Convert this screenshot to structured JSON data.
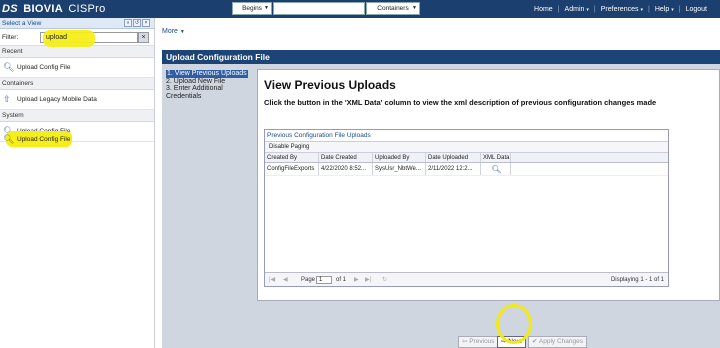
{
  "header": {
    "logo_prefix": "DS",
    "brand": "BIOVIA",
    "product": "CISPro",
    "search_mode": "Begins",
    "search_value": "",
    "search_scope": "Containers",
    "nav": [
      "Home",
      "Admin",
      "Preferences",
      "Help",
      "Logout"
    ]
  },
  "sidebar": {
    "title": "Select a View",
    "controls": [
      "«",
      "↺",
      "×"
    ],
    "filter_label": "Filter:",
    "filter_value": "upload",
    "clear": "×",
    "groups": [
      {
        "name": "Recent",
        "item": "Upload Config File",
        "icon": "magnifier-icon"
      },
      {
        "name": "Containers",
        "item": "Upload Legacy Mobile Data",
        "icon": "upload-arrow-icon"
      },
      {
        "name": "System",
        "item": "Upload Config File",
        "icon": "magnifier-icon"
      }
    ]
  },
  "main": {
    "more": "More",
    "panel_title": "Upload Configuration File",
    "steps": [
      "1. View Previous Uploads",
      "2. Upload New File",
      "3. Enter Additional Credentials"
    ],
    "heading": "View Previous Uploads",
    "instruction": "Click the button in the 'XML Data' column to view the xml description of previous configuration changes made",
    "grid": {
      "title": "Previous Configuration File Uploads",
      "toolbar": "Disable Paging",
      "columns": [
        "Created By",
        "Date Created",
        "Uploaded By",
        "Date Uploaded",
        "XML Data"
      ],
      "rows": [
        [
          "ConfigFileExports",
          "4/22/2020 8:52...",
          "SysUsr_NbtWe...",
          "2/11/2022 12:2..."
        ]
      ],
      "pager": {
        "page_label": "Page",
        "page": "1",
        "of": "of 1",
        "display": "Displaying 1 - 1 of 1"
      }
    },
    "buttons": {
      "previous": "Previous",
      "next": "Next",
      "apply": "Apply Changes"
    }
  },
  "colors": {
    "header": "#1b3f6e",
    "highlight": "#f5ee1a",
    "panel": "#1c4477"
  }
}
